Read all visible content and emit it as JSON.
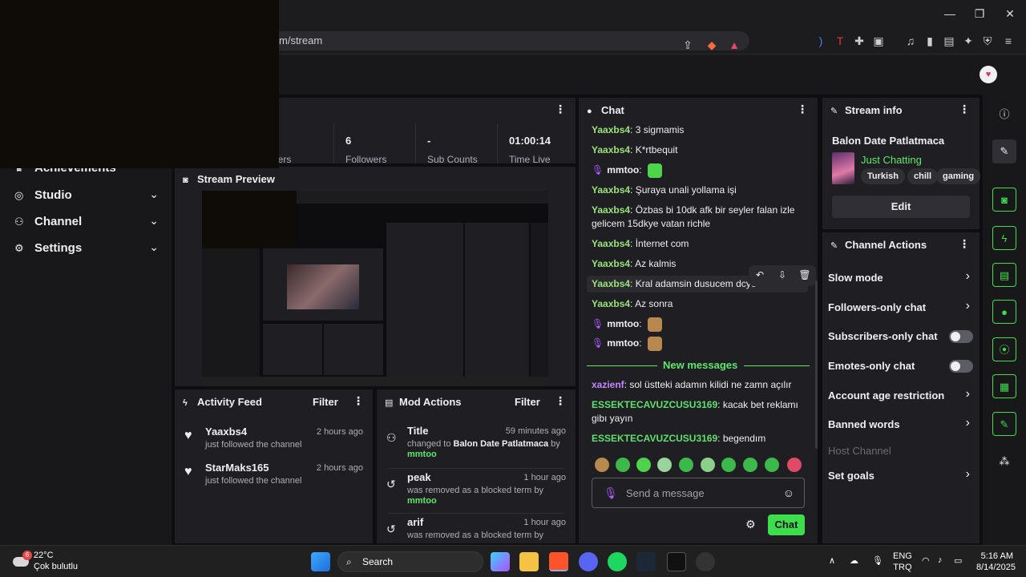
{
  "browser": {
    "url": "m/stream",
    "minimize": "—",
    "maximize": "❐",
    "close": "✕"
  },
  "nav": [
    {
      "label": "Achievements",
      "icon": "trophy-icon"
    },
    {
      "label": "Studio",
      "icon": "studio-icon"
    },
    {
      "label": "Channel",
      "icon": "channel-icon"
    },
    {
      "label": "Settings",
      "icon": "gear-icon"
    }
  ],
  "stats": [
    {
      "value": "6",
      "label": "Followers"
    },
    {
      "value": "-",
      "label": "Sub Counts"
    },
    {
      "value": "01:00:14",
      "label": "Time Live"
    }
  ],
  "stats_partial_label": "...wers",
  "preview": {
    "title": "Stream Preview"
  },
  "activity": {
    "title": "Activity Feed",
    "filter": "Filter",
    "items": [
      {
        "name": "Yaaxbs4",
        "sub": "just followed the channel",
        "time": "2 hours ago"
      },
      {
        "name": "StarMaks165",
        "sub": "just followed the channel",
        "time": "2 hours ago"
      }
    ]
  },
  "mod": {
    "title": "Mod Actions",
    "filter": "Filter",
    "items": [
      {
        "title": "Title",
        "time": "59 minutes ago",
        "pre": "changed to ",
        "target": "Balon Date Patlatmaca",
        "mid": " by ",
        "by": "mmtoo"
      },
      {
        "title": "peak",
        "time": "1 hour ago",
        "pre": "was removed as a blocked term by",
        "target": "",
        "mid": "",
        "by": "mmtoo"
      },
      {
        "title": "arif",
        "time": "1 hour ago",
        "pre": "was removed as a blocked term by",
        "target": "",
        "mid": "",
        "by": ""
      }
    ]
  },
  "chat": {
    "title": "Chat",
    "messages": [
      {
        "user": "Yaaxbs4",
        "text": "3 sigmamis"
      },
      {
        "user": "Yaaxbs4",
        "text": "K*rtbequit"
      },
      {
        "user": "mmtoo",
        "text": ""
      },
      {
        "user": "Yaaxbs4",
        "text": "Şuraya unali yollama işi"
      },
      {
        "user": "Yaaxbs4",
        "text": "Özbas bi 10dk afk bir seyler falan izle gelicem 15dkye vatan richle"
      },
      {
        "user": "Yaaxbs4",
        "text": "İnternet com"
      },
      {
        "user": "Yaaxbs4",
        "text": "Az kalmis"
      },
      {
        "user": "Yaaxbs4",
        "text": "Kral adamsin dusucem dcye"
      },
      {
        "user": "Yaaxbs4",
        "text": "Az sonra"
      },
      {
        "user": "mmtoo",
        "text": ""
      },
      {
        "user": "mmtoo",
        "text": ""
      }
    ],
    "new_messages": "New messages",
    "new": [
      {
        "user": "xazienf",
        "text": "sol üstteki adamın kilidi ne zamn açılır"
      },
      {
        "user": "ESSEKTECAVUZCUSU3169",
        "text": "kacak bet reklamı gibı yayın"
      },
      {
        "user": "ESSEKTECAVUZCUSU3169",
        "text": "begendım"
      }
    ],
    "placeholder": "Send a message",
    "send": "Chat"
  },
  "info": {
    "title": "Stream info",
    "stream_title": "Balon Date Patlatmaca",
    "category": "Just Chatting",
    "tags": [
      "Turkish",
      "chill",
      "gaming"
    ],
    "edit": "Edit"
  },
  "actions": {
    "title": "Channel Actions",
    "items": [
      {
        "label": "Slow mode",
        "kind": "chevron"
      },
      {
        "label": "Followers-only chat",
        "kind": "chevron"
      },
      {
        "label": "Subscribers-only chat",
        "kind": "toggle"
      },
      {
        "label": "Emotes-only chat",
        "kind": "toggle"
      },
      {
        "label": "Account age restriction",
        "kind": "chevron"
      },
      {
        "label": "Banned words",
        "kind": "chevron"
      },
      {
        "label": "Host Channel",
        "kind": "disabled"
      },
      {
        "label": "Set goals",
        "kind": "chevron"
      }
    ]
  },
  "taskbar": {
    "temp": "22°C",
    "weather": "Çok bulutlu",
    "weather_badge": "6",
    "search": "Search",
    "lang1": "ENG",
    "lang2": "TRQ",
    "time": "5:16 AM",
    "date": "8/14/2025"
  },
  "colors": {
    "accent": "#53fc18",
    "chat_user": "#9be27a",
    "purple": "#b45cff"
  }
}
